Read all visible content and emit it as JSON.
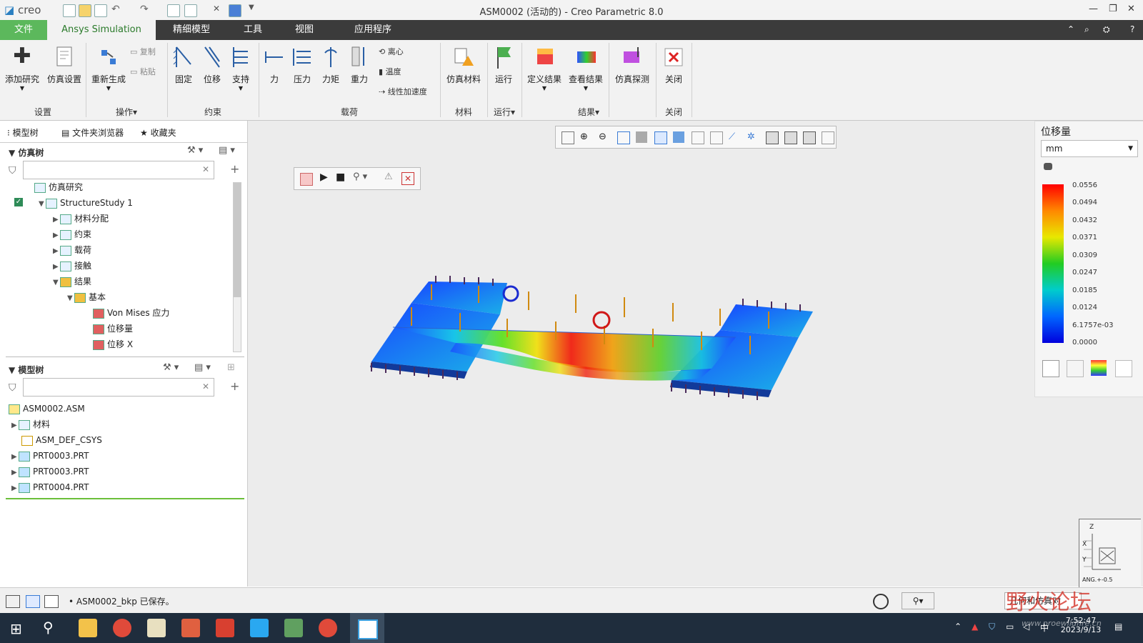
{
  "titlebar": {
    "logo": "creo",
    "title": "ASM0002 (活动的) - Creo Parametric 8.0"
  },
  "tabs": [
    {
      "label": "文件"
    },
    {
      "label": "Ansys Simulation"
    },
    {
      "label": "精细模型"
    },
    {
      "label": "工具"
    },
    {
      "label": "视图"
    },
    {
      "label": "应用程序"
    }
  ],
  "ribbon": {
    "buttons": {
      "add_study": "添加研究",
      "sim_settings": "仿真设置",
      "regenerate": "重新生成",
      "copy": "复制",
      "paste": "粘贴",
      "fixed": "固定",
      "displacement": "位移",
      "support": "支持",
      "force": "力",
      "pressure": "压力",
      "moment": "力矩",
      "gravity": "重力",
      "centrifugal": "离心",
      "temperature": "温度",
      "linear_accel": "线性加速度",
      "sim_material": "仿真材料",
      "run": "运行",
      "define_result": "定义结果",
      "view_result": "查看结果",
      "sim_probe": "仿真探测",
      "close": "关闭"
    },
    "groups": {
      "setup": "设置",
      "operations": "操作▾",
      "constraints": "约束",
      "loads": "载荷",
      "material": "材料",
      "run": "运行▾",
      "results": "结果▾",
      "close": "关闭"
    }
  },
  "left_panel": {
    "tabs": [
      "模型树",
      "文件夹浏览器",
      "收藏夹"
    ],
    "sim_tree": {
      "header": "仿真树",
      "items": [
        {
          "label": "仿真研究"
        },
        {
          "label": "StructureStudy 1"
        },
        {
          "label": "材料分配"
        },
        {
          "label": "约束"
        },
        {
          "label": "载荷"
        },
        {
          "label": "接触"
        },
        {
          "label": "结果"
        },
        {
          "label": "基本"
        },
        {
          "label": "Von Mises 应力"
        },
        {
          "label": "位移量"
        },
        {
          "label": "位移 X"
        }
      ]
    },
    "model_tree": {
      "header": "模型树",
      "items": [
        {
          "label": "ASM0002.ASM"
        },
        {
          "label": "材料"
        },
        {
          "label": "ASM_DEF_CSYS"
        },
        {
          "label": "PRT0003.PRT"
        },
        {
          "label": "PRT0003.PRT"
        },
        {
          "label": "PRT0004.PRT"
        }
      ]
    }
  },
  "legend": {
    "title": "位移量",
    "unit": "mm",
    "values": [
      "0.0556",
      "0.0494",
      "0.0432",
      "0.0371",
      "0.0309",
      "0.0247",
      "0.0185",
      "0.0124",
      "6.1757e-03",
      "0.0000"
    ]
  },
  "status": {
    "message": "ASM0002_bkp 已保存。",
    "right_label": "几何和仿真对"
  },
  "taskbar": {
    "time": "7:52:47",
    "date": "2023/9/13",
    "lang": "中"
  },
  "watermark": "野火论坛",
  "watermark_url": "www.proewildfire.cn",
  "csys": {
    "z": "Z",
    "x": "X",
    "y": "Y",
    "ang": "ANG.+-0.5"
  }
}
